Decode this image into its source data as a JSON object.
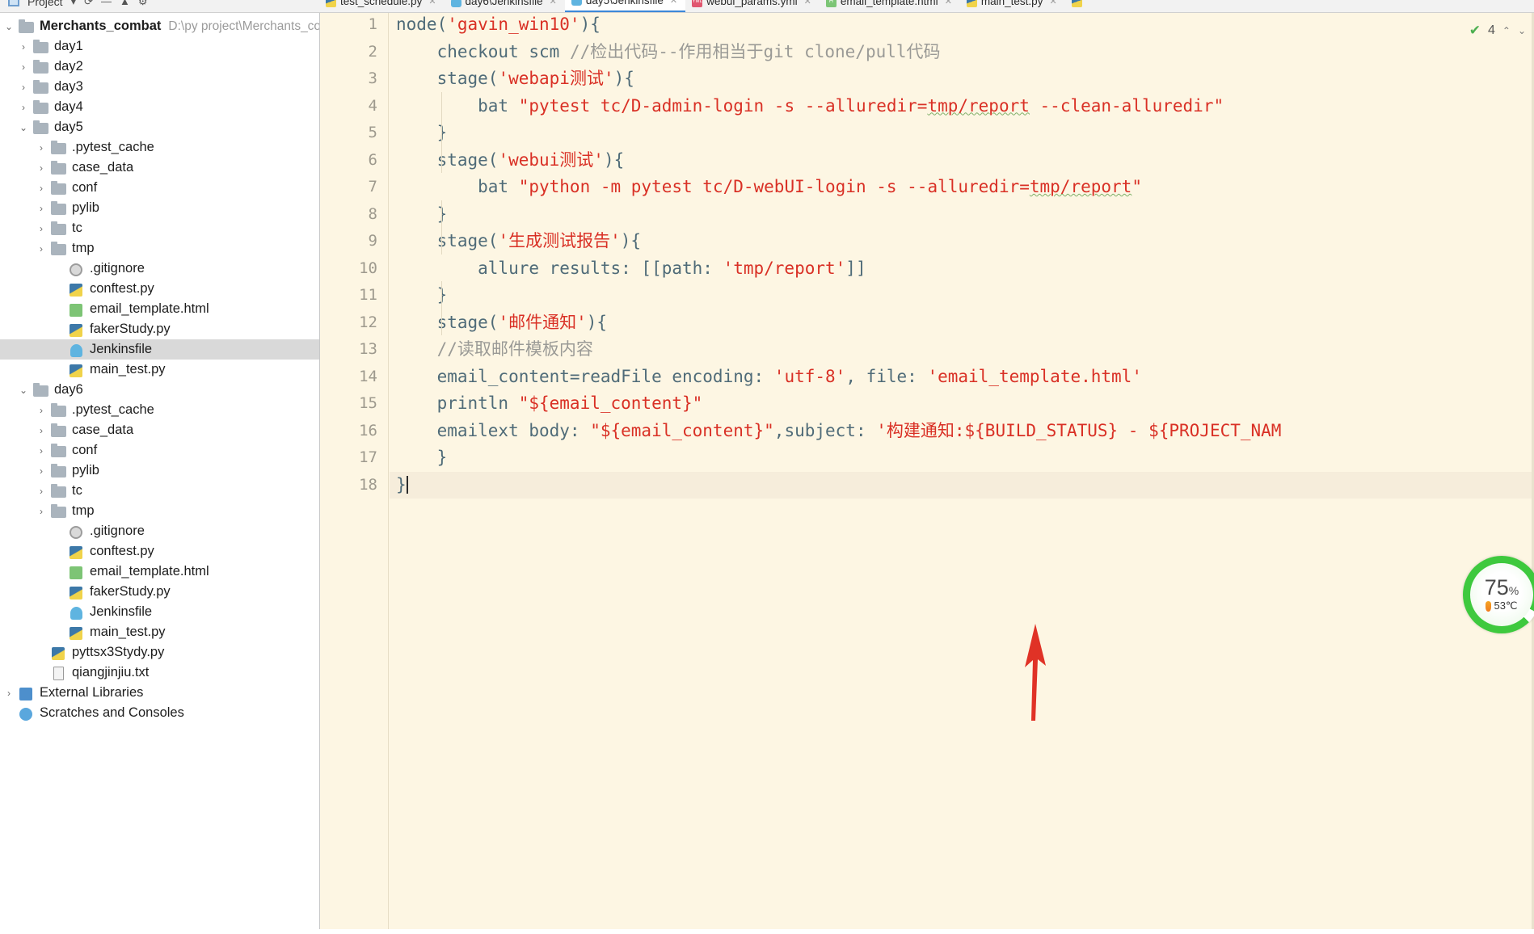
{
  "window": {
    "toolbar_label": "Project",
    "toolbar_icons": [
      "project-icon",
      "dropdown-icon",
      "sync-icon",
      "minimize-icon",
      "collapse-icon",
      "settings-icon"
    ]
  },
  "tabs": [
    {
      "label": "test_schedule.py",
      "icon": "python-file-icon",
      "active": false
    },
    {
      "label": "day6\\Jenkinsfile",
      "icon": "jenkins-file-icon",
      "active": false
    },
    {
      "label": "day5\\Jenkinsfile",
      "icon": "jenkins-file-icon",
      "active": true
    },
    {
      "label": "webui_params.yml",
      "icon": "yaml-file-icon",
      "active": false
    },
    {
      "label": "email_template.html",
      "icon": "html-file-icon",
      "active": false
    },
    {
      "label": "main_test.py",
      "icon": "python-file-icon",
      "active": false
    }
  ],
  "project_tree": {
    "root": {
      "label": "Merchants_combat",
      "path": "D:\\py project\\Merchants_cor",
      "icon": "folder-icon",
      "expanded": true
    },
    "items": [
      {
        "label": "day1",
        "icon": "folder-icon",
        "depth": 1,
        "arrow": "right",
        "selected": false
      },
      {
        "label": "day2",
        "icon": "folder-icon",
        "depth": 1,
        "arrow": "right",
        "selected": false
      },
      {
        "label": "day3",
        "icon": "folder-icon",
        "depth": 1,
        "arrow": "right",
        "selected": false
      },
      {
        "label": "day4",
        "icon": "folder-icon",
        "depth": 1,
        "arrow": "right",
        "selected": false
      },
      {
        "label": "day5",
        "icon": "folder-icon",
        "depth": 1,
        "arrow": "down",
        "selected": false
      },
      {
        "label": ".pytest_cache",
        "icon": "folder-icon",
        "depth": 2,
        "arrow": "right",
        "selected": false
      },
      {
        "label": "case_data",
        "icon": "folder-icon",
        "depth": 2,
        "arrow": "right",
        "selected": false
      },
      {
        "label": "conf",
        "icon": "folder-icon",
        "depth": 2,
        "arrow": "right",
        "selected": false
      },
      {
        "label": "pylib",
        "icon": "folder-icon",
        "depth": 2,
        "arrow": "right",
        "selected": false
      },
      {
        "label": "tc",
        "icon": "folder-icon",
        "depth": 2,
        "arrow": "right",
        "selected": false
      },
      {
        "label": "tmp",
        "icon": "folder-icon",
        "depth": 2,
        "arrow": "right",
        "selected": false
      },
      {
        "label": ".gitignore",
        "icon": "gitignore-file-icon",
        "depth": 2,
        "arrow": "none",
        "selected": false
      },
      {
        "label": "conftest.py",
        "icon": "python-file-icon",
        "depth": 2,
        "arrow": "none",
        "selected": false
      },
      {
        "label": "email_template.html",
        "icon": "html-file-icon",
        "depth": 2,
        "arrow": "none",
        "selected": false
      },
      {
        "label": "fakerStudy.py",
        "icon": "python-file-icon",
        "depth": 2,
        "arrow": "none",
        "selected": false
      },
      {
        "label": "Jenkinsfile",
        "icon": "jenkins-file-icon",
        "depth": 2,
        "arrow": "none",
        "selected": true
      },
      {
        "label": "main_test.py",
        "icon": "python-file-icon",
        "depth": 2,
        "arrow": "none",
        "selected": false
      },
      {
        "label": "day6",
        "icon": "folder-icon",
        "depth": 1,
        "arrow": "down",
        "selected": false
      },
      {
        "label": ".pytest_cache",
        "icon": "folder-icon",
        "depth": 2,
        "arrow": "right",
        "selected": false
      },
      {
        "label": "case_data",
        "icon": "folder-icon",
        "depth": 2,
        "arrow": "right",
        "selected": false
      },
      {
        "label": "conf",
        "icon": "folder-icon",
        "depth": 2,
        "arrow": "right",
        "selected": false
      },
      {
        "label": "pylib",
        "icon": "folder-icon",
        "depth": 2,
        "arrow": "right",
        "selected": false
      },
      {
        "label": "tc",
        "icon": "folder-icon",
        "depth": 2,
        "arrow": "right",
        "selected": false
      },
      {
        "label": "tmp",
        "icon": "folder-icon",
        "depth": 2,
        "arrow": "right",
        "selected": false
      },
      {
        "label": ".gitignore",
        "icon": "gitignore-file-icon",
        "depth": 2,
        "arrow": "none",
        "selected": false
      },
      {
        "label": "conftest.py",
        "icon": "python-file-icon",
        "depth": 2,
        "arrow": "none",
        "selected": false
      },
      {
        "label": "email_template.html",
        "icon": "html-file-icon",
        "depth": 2,
        "arrow": "none",
        "selected": false
      },
      {
        "label": "fakerStudy.py",
        "icon": "python-file-icon",
        "depth": 2,
        "arrow": "none",
        "selected": false
      },
      {
        "label": "Jenkinsfile",
        "icon": "jenkins-file-icon",
        "depth": 2,
        "arrow": "none",
        "selected": false
      },
      {
        "label": "main_test.py",
        "icon": "python-file-icon",
        "depth": 2,
        "arrow": "none",
        "selected": false
      },
      {
        "label": "pyttsx3Stydy.py",
        "icon": "python-file-icon",
        "depth": 1,
        "arrow": "none",
        "selected": false
      },
      {
        "label": "qiangjinjiu.txt",
        "icon": "text-file-icon",
        "depth": 1,
        "arrow": "none",
        "selected": false
      },
      {
        "label": "External Libraries",
        "icon": "library-icon",
        "depth": 0,
        "arrow": "right",
        "selected": false
      },
      {
        "label": "Scratches and Consoles",
        "icon": "scratches-icon",
        "depth": 0,
        "arrow": "none",
        "selected": false
      }
    ]
  },
  "editor": {
    "file": "Jenkinsfile",
    "line_numbers": [
      "1",
      "2",
      "3",
      "4",
      "5",
      "6",
      "7",
      "8",
      "9",
      "10",
      "11",
      "12",
      "13",
      "14",
      "15",
      "16",
      "17",
      "18"
    ],
    "current_line": 18,
    "lines": [
      "node('gavin_win10'){",
      "    checkout scm //检出代码--作用相当于git clone/pull代码",
      "    stage('webapi测试'){",
      "        bat \"pytest tc/D-admin-login -s --alluredir=tmp/report --clean-alluredir\"",
      "    }",
      "    stage('webui测试'){",
      "        bat \"python -m pytest tc/D-webUI-login -s --alluredir=tmp/report\"",
      "    }",
      "    stage('生成测试报告'){",
      "        allure results: [[path: 'tmp/report']]",
      "    }",
      "    stage('邮件通知'){",
      "    //读取邮件模板内容",
      "    email_content=readFile encoding: 'utf-8', file: 'email_template.html'",
      "    println \"${email_content}\"",
      "    emailext body: \"${email_content}\",subject: '构建通知:${BUILD_STATUS} - ${PROJECT_NAM",
      "    }",
      "}"
    ]
  },
  "inspections": {
    "count": "4",
    "status_icon": "check-mark-icon",
    "up_icon": "chevron-up-icon",
    "down_icon": "chevron-down-icon"
  },
  "cpu_gauge": {
    "percent": "75",
    "percent_symbol": "%",
    "temperature": "53℃",
    "thermo_icon": "thermometer-icon",
    "ring_color": "#3ec93e"
  },
  "annotation": {
    "arrow_color": "#e03226",
    "type": "red-up-arrow"
  },
  "colors": {
    "editor_bg": "#fdf6e3",
    "string": "#d93025",
    "keyword": "#4f6b78",
    "comment": "#9a9a96",
    "selection": "#d9d9d9",
    "tab_active_underline": "#3c88d8"
  }
}
